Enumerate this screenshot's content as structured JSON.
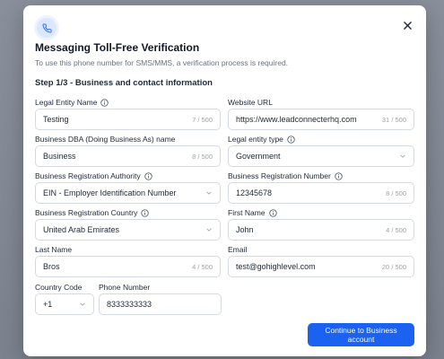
{
  "modal": {
    "title": "Messaging Toll-Free Verification",
    "subtitle": "To use this phone number for SMS/MMS, a verification process is required.",
    "step": "Step 1/3 - Business and contact information"
  },
  "fields": {
    "legal_entity_name": {
      "label": "Legal Entity Name",
      "value": "Testing",
      "count": "7 / 500"
    },
    "website_url": {
      "label": "Website URL",
      "value": "https://www.leadconnecterhq.com",
      "count": "31 / 500"
    },
    "business_dba": {
      "label": "Business DBA (Doing Business As) name",
      "value": "Business",
      "count": "8 / 500"
    },
    "legal_entity_type": {
      "label": "Legal entity type",
      "value": "Government"
    },
    "registration_authority": {
      "label": "Business Registration Authority",
      "value": "EIN - Employer Identification Number"
    },
    "registration_number": {
      "label": "Business Registration Number",
      "value": "12345678",
      "count": "8 / 500"
    },
    "registration_country": {
      "label": "Business Registration Country",
      "value": "United Arab Emirates"
    },
    "first_name": {
      "label": "First Name",
      "value": "John",
      "count": "4 / 500"
    },
    "last_name": {
      "label": "Last Name",
      "value": "Bros",
      "count": "4 / 500"
    },
    "email": {
      "label": "Email",
      "value": "test@gohighlevel.com",
      "count": "20 / 500"
    },
    "country_code": {
      "label": "Country Code",
      "value": "+1"
    },
    "phone_number": {
      "label": "Phone Number",
      "value": "8333333333"
    }
  },
  "actions": {
    "continue_label": "Continue to Business account"
  },
  "colors": {
    "primary": "#1c62f0",
    "icon_badge": "#dbe7fd",
    "overlay": "#7e8591"
  },
  "icons": {
    "header": "phone-icon",
    "close": "close-icon",
    "info": "info-icon",
    "dropdown": "chevron-down-icon"
  }
}
